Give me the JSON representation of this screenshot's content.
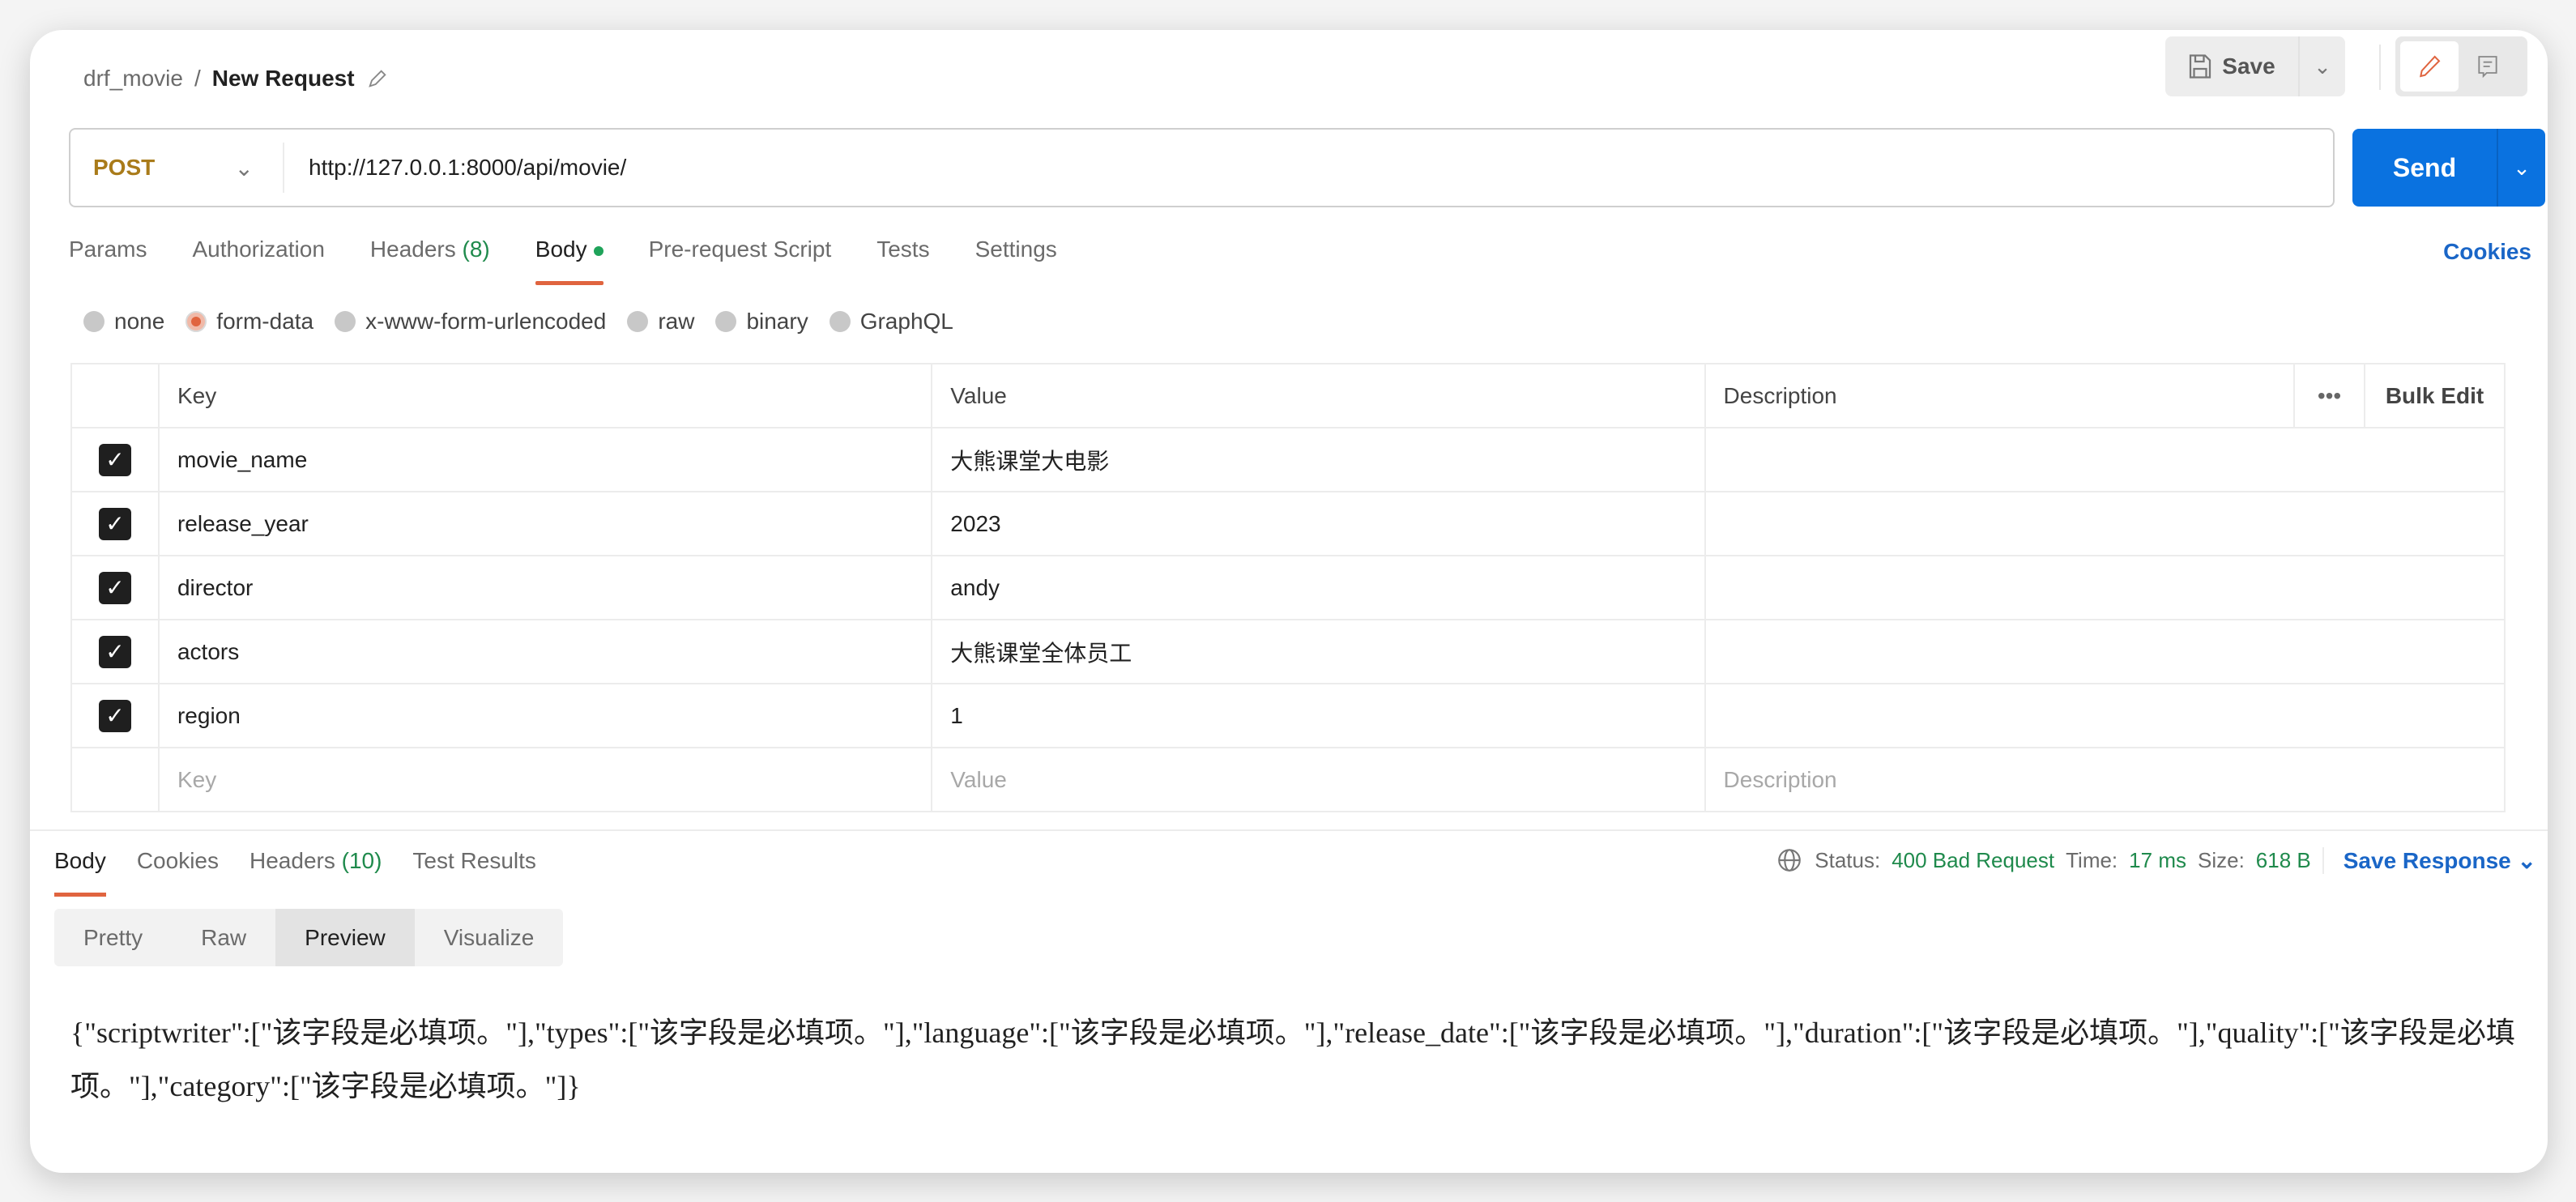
{
  "breadcrumb": {
    "collection": "drf_movie",
    "separator": "/",
    "request": "New Request"
  },
  "toolbar": {
    "save_label": "Save"
  },
  "request": {
    "method": "POST",
    "url": "http://127.0.0.1:8000/api/movie/",
    "send_label": "Send"
  },
  "tabs": [
    {
      "label": "Params"
    },
    {
      "label": "Authorization"
    },
    {
      "label": "Headers",
      "count": "(8)"
    },
    {
      "label": "Body"
    },
    {
      "label": "Pre-request Script"
    },
    {
      "label": "Tests"
    },
    {
      "label": "Settings"
    }
  ],
  "cookies_label": "Cookies",
  "body_types": [
    "none",
    "form-data",
    "x-www-form-urlencoded",
    "raw",
    "binary",
    "GraphQL"
  ],
  "body_type_selected": "form-data",
  "table": {
    "headers": {
      "key": "Key",
      "value": "Value",
      "description": "Description",
      "bulk_edit": "Bulk Edit"
    },
    "rows": [
      {
        "key": "movie_name",
        "value": "大熊课堂大电影",
        "checked": true
      },
      {
        "key": "release_year",
        "value": "2023",
        "checked": true
      },
      {
        "key": "director",
        "value": "andy",
        "checked": true
      },
      {
        "key": "actors",
        "value": "大熊课堂全体员工",
        "checked": true
      },
      {
        "key": "region",
        "value": "1",
        "checked": true
      }
    ],
    "placeholder": {
      "key": "Key",
      "value": "Value",
      "description": "Description"
    }
  },
  "response": {
    "tabs": [
      {
        "label": "Body"
      },
      {
        "label": "Cookies"
      },
      {
        "label": "Headers",
        "count": "(10)"
      },
      {
        "label": "Test Results"
      }
    ],
    "status_label": "Status:",
    "status": "400 Bad Request",
    "time_label": "Time:",
    "time": "17 ms",
    "size_label": "Size:",
    "size": "618 B",
    "save_label": "Save Response",
    "views": [
      "Pretty",
      "Raw",
      "Preview",
      "Visualize"
    ],
    "active_view": "Preview",
    "body": "{\"scriptwriter\":[\"该字段是必填项。\"],\"types\":[\"该字段是必填项。\"],\"language\":[\"该字段是必填项。\"],\"release_date\":[\"该字段是必填项。\"],\"duration\":[\"该字段是必填项。\"],\"quality\":[\"该字段是必填项。\"],\"category\":[\"该字段是必填项。\"]}"
  },
  "colors": {
    "accent": "#e0643f",
    "send": "#0a72e0",
    "method": "#a97b1a",
    "status": "#1f8a4c",
    "link": "#1a66c7"
  }
}
